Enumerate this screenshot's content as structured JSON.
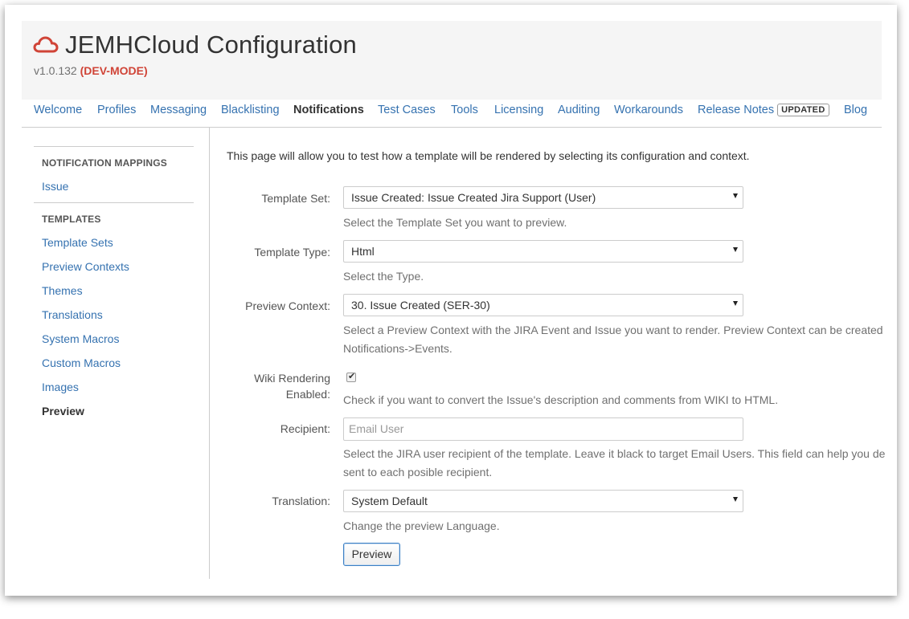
{
  "header": {
    "title": "JEMHCloud Configuration",
    "version": "v1.0.132",
    "dev_mode": "(DEV-MODE)",
    "logo_icon": "cloud-icon",
    "brand_color": "#d04437"
  },
  "nav": {
    "items": [
      {
        "label": "Welcome"
      },
      {
        "label": "Profiles"
      },
      {
        "label": "Messaging"
      },
      {
        "label": "Blacklisting"
      },
      {
        "label": "Notifications",
        "active": true
      },
      {
        "label": "Test Cases"
      },
      {
        "label": "Tools"
      },
      {
        "label": "Licensing"
      },
      {
        "label": "Auditing"
      },
      {
        "label": "Workarounds"
      },
      {
        "label": "Release Notes",
        "badge": "UPDATED"
      },
      {
        "label": "Blog"
      }
    ]
  },
  "sidebar": {
    "sections": [
      {
        "heading": "NOTIFICATION MAPPINGS",
        "links": [
          "Issue"
        ]
      },
      {
        "heading": "TEMPLATES",
        "links": [
          "Template Sets",
          "Preview Contexts",
          "Themes",
          "Translations",
          "System Macros",
          "Custom Macros",
          "Images",
          "Preview"
        ]
      }
    ],
    "current": "Preview"
  },
  "main": {
    "intro": "This page will allow you to test how a template will be rendered by selecting its configuration and context.",
    "template_set": {
      "label": "Template Set:",
      "value": "Issue Created: Issue Created Jira Support (User)",
      "help": "Select the Template Set you want to preview."
    },
    "template_type": {
      "label": "Template Type:",
      "value": "Html",
      "help": "Select the Type."
    },
    "preview_context": {
      "label": "Preview Context:",
      "value": "30. Issue Created (SER-30)",
      "help_line1": "Select a Preview Context with the JIRA Event and Issue you want to render. Preview Context can be created",
      "help_line2": "Notifications->Events."
    },
    "wiki_rendering": {
      "label_line1": "Wiki Rendering",
      "label_line2": "Enabled:",
      "checked": true,
      "help": "Check if you want to convert the Issue's description and comments from WIKI to HTML."
    },
    "recipient": {
      "label": "Recipient:",
      "placeholder": "Email User",
      "help_line1": "Select the JIRA user recipient of the template. Leave it black to target Email Users. This field can help you de",
      "help_line2": "sent to each posible recipient."
    },
    "translation": {
      "label": "Translation:",
      "value": "System Default",
      "help": "Change the preview Language."
    },
    "preview_button": "Preview"
  },
  "colors": {
    "link": "#3572b0",
    "header_bg": "#f5f5f5",
    "button_border": "#3b7fc4"
  }
}
